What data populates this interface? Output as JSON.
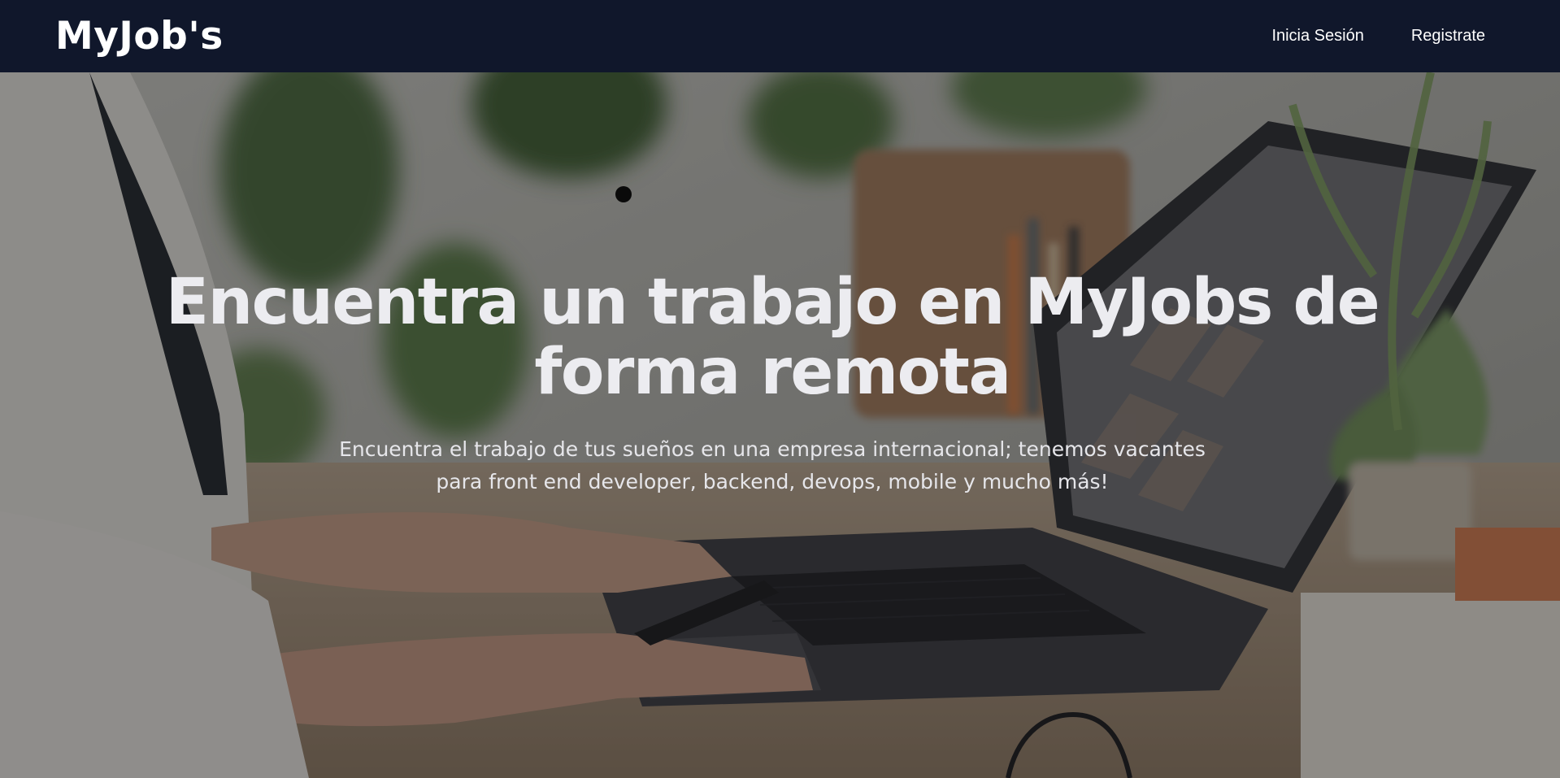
{
  "navbar": {
    "logo": "MyJob's",
    "links": [
      {
        "label": "Inicia Sesión"
      },
      {
        "label": "Registrate"
      }
    ]
  },
  "hero": {
    "title": "Encuentra un trabajo en MyJobs de forma remota",
    "subtitle": "Encuentra el trabajo de tus sueños en una empresa internacional; tenemos vacantes para front end developer, backend, devops, mobile y mucho más!",
    "background_image": "person-typing-on-laptop-photo"
  },
  "colors": {
    "navbar_bg": "#10172b",
    "text": "#ffffff"
  }
}
